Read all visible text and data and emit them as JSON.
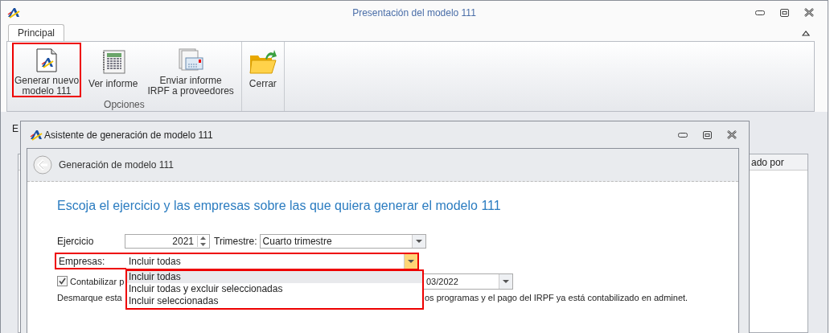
{
  "window": {
    "title": "Presentación del modelo 111"
  },
  "tabs": [
    {
      "label": "Principal",
      "selected": true
    }
  ],
  "ribbon": {
    "groups": [
      {
        "label": "Opciones",
        "buttons": [
          {
            "label": "Generar nuevo\nmodelo 111",
            "kind": "new-document",
            "highlighted": true
          },
          {
            "label": "Ver informe",
            "kind": "report",
            "highlighted": false
          },
          {
            "label": "Enviar informe\nIRPF a proveedores",
            "kind": "send",
            "highlighted": false
          }
        ]
      },
      {
        "buttons": [
          {
            "label": "Cerrar",
            "kind": "folder",
            "highlighted": false
          }
        ]
      }
    ]
  },
  "background": {
    "label_fragment": "E",
    "table": {
      "columns": [
        "ado por"
      ]
    }
  },
  "dialog": {
    "title": "Asistente de generación de modelo 111",
    "header": "Generación de modelo 111",
    "heading": "Escoja el ejercicio y las empresas sobre las que quiera generar el modelo 111",
    "ejercicio": {
      "label": "Ejercicio",
      "value": "2021"
    },
    "trimestre": {
      "label": "Trimestre:",
      "value": "Cuarto trimestre"
    },
    "empresas": {
      "label": "Empresas:",
      "value": "Incluir todas",
      "highlighted": true,
      "expanded": true,
      "options": [
        {
          "label": "Incluir todas",
          "selected": true
        },
        {
          "label": "Incluir todas y excluir seleccionadas",
          "selected": false
        },
        {
          "label": "Incluir seleccionadas",
          "selected": false
        }
      ]
    },
    "contabilizar": {
      "label": "Contabilizar p",
      "checked": true,
      "date": "03/2022"
    },
    "note": [
      "Desmarque esta",
      "os programas y el pago del IRPF ya está contabilizado en adminet."
    ]
  }
}
